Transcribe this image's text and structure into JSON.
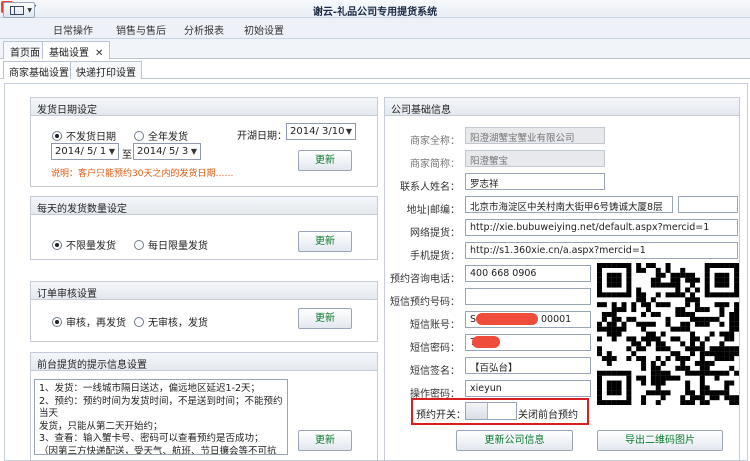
{
  "window": {
    "title": "谢云-礼品公司专用提货系统"
  },
  "menu": [
    "日常操作",
    "销售与售后",
    "分析报表",
    "初始设置"
  ],
  "tabs": [
    {
      "label": "首页面"
    },
    {
      "label": "基础设置"
    }
  ],
  "subtabs": [
    "商家基础设置",
    "快递打印设置"
  ],
  "ship_date": {
    "title": "发货日期设定",
    "option_no_ship": "不发货日期",
    "option_all_year": "全年发货",
    "from": "2014/ 5/ 1",
    "to_label": "至",
    "to": "2014/ 5/ 3",
    "open_label": "开湖日期：",
    "open_date": "2014/ 3/10",
    "note": "说明：客户只能预约30天之内的发货日期……",
    "update": "更新"
  },
  "daily_qty": {
    "title": "每天的发货数量设定",
    "option_unlimited": "不限量发货",
    "option_limited": "每日限量发货",
    "update": "更新"
  },
  "order_review": {
    "title": "订单审核设置",
    "option_review": "审核，再发货",
    "option_no_review": "无审核，发货",
    "update": "更新"
  },
  "tips": {
    "title": "前台提货的提示信息设置",
    "lines": [
      "1、发货：一线城市隔日送达，偏远地区延迟1-2天；",
      "2、预约：预约时间为发货时间，不是送到时间；不能预约当天",
      "发货，只能从第二天开始约；",
      "3、查看：输入蟹卡号、密码可以查看预约是否成功；",
      "（因第三方快递配送，受天气、航班、节日攘会等不可抗因素影"
    ],
    "update": "更新"
  },
  "company": {
    "title": "公司基础信息",
    "fields": [
      {
        "label": "商家全称：",
        "value": "阳澄湖蟹宝蟹业有限公司"
      },
      {
        "label": "商家简称：",
        "value": "阳澄蟹宝"
      },
      {
        "label": "联系人姓名：",
        "value": "罗志祥"
      },
      {
        "label": "地址|邮编：",
        "value": "北京市海淀区中关村南大街甲6号铸诚大厦8层"
      },
      {
        "label": "网络提货：",
        "value": "http://xie.bubuweiying.net/default.aspx?mercid=1"
      },
      {
        "label": "手机提货：",
        "value": "http://s1.360xie.cn/a.aspx?mercid=1"
      },
      {
        "label": "预约咨询电话：",
        "value": "400 668 0906"
      },
      {
        "label": "短信预约号码：",
        "value": ""
      },
      {
        "label": "短信账号：",
        "value": "S",
        "value_end": "00001"
      },
      {
        "label": "短信密码：",
        "value": "7"
      },
      {
        "label": "短信签名：",
        "value": "【百弘台】"
      },
      {
        "label": "操作密码：",
        "value": "xieyun"
      }
    ],
    "switch_label": "预约开关：",
    "switch_text": "关闭前台预约",
    "update_button": "更新公司信息",
    "export_button": "导出二维码图片"
  },
  "colors": {
    "accent_green": "#0b7a2e",
    "warn_orange": "#e05a12",
    "highlight_red": "#d81e1e"
  }
}
